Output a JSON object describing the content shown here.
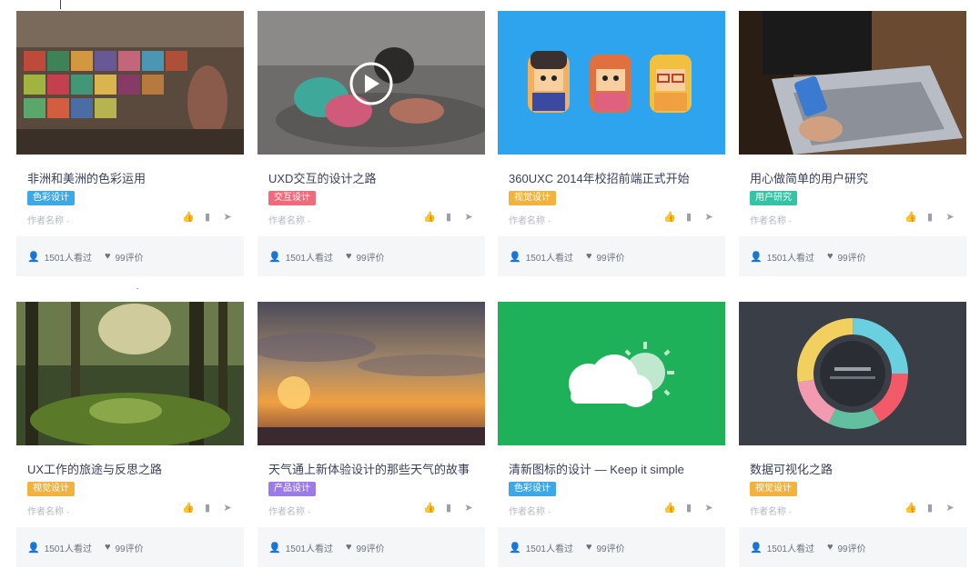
{
  "cards": [
    {
      "title": "非洲和美洲的色彩运用",
      "tag": "色彩设计",
      "tag_color": "#3ea8e6",
      "author": "作者名称 ·",
      "views": "1501人看过",
      "likes": "99评价",
      "thumb": "market"
    },
    {
      "title": "UXD交互的设计之路",
      "tag": "交互设计",
      "tag_color": "#ef6b7b",
      "author": "作者名称 ·",
      "views": "1501人看过",
      "likes": "99评价",
      "thumb": "girl"
    },
    {
      "title": "360UXC 2014年校招前端正式开始",
      "tag": "视觉设计",
      "tag_color": "#f2b23e",
      "author": "作者名称 ·",
      "views": "1501人看过",
      "likes": "99评价",
      "thumb": "avatars"
    },
    {
      "title": "用心做简单的用户研究",
      "tag": "用户研究",
      "tag_color": "#34c3a3",
      "author": "作者名称 ·",
      "views": "1501人看过",
      "likes": "99评价",
      "thumb": "laptop"
    },
    {
      "title": "UX工作的旅途与反思之路",
      "tag": "视觉设计",
      "tag_color": "#f2b23e",
      "author": "作者名称 ·",
      "views": "1501人看过",
      "likes": "99评价",
      "thumb": "forest"
    },
    {
      "title": "天气通上新体验设计的那些天气的故事",
      "tag": "产品设计",
      "tag_color": "#9b7be8",
      "author": "作者名称 ·",
      "views": "1501人看过",
      "likes": "99评价",
      "thumb": "sunset"
    },
    {
      "title": "清新图标的设计 — Keep it simple",
      "tag": "色彩设计",
      "tag_color": "#3ea8e6",
      "author": "作者名称 ·",
      "views": "1501人看过",
      "likes": "99评价",
      "thumb": "weather"
    },
    {
      "title": "数据可视化之路",
      "tag": "视觉设计",
      "tag_color": "#f2b23e",
      "author": "作者名称 ·",
      "views": "1501人看过",
      "likes": "99评价",
      "thumb": "donut"
    }
  ],
  "icons": {
    "action_1": "thumbs-up-icon",
    "action_2": "bookmark-icon",
    "action_3": "share-icon",
    "views_icon": "user-icon",
    "likes_icon": "heart-icon"
  },
  "colors": {
    "tag_blue": "#3ea8e6",
    "tag_red": "#ef6b7b",
    "tag_orange": "#f2b23e",
    "tag_green": "#34c3a3",
    "tag_purple": "#9b7be8"
  }
}
